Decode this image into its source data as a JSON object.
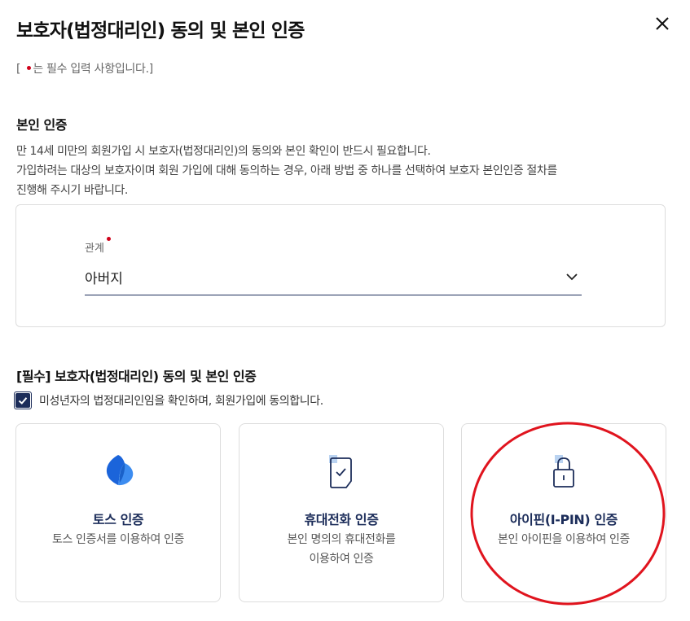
{
  "dialog": {
    "title": "보호자(법정대리인) 동의 및 본인 인증",
    "close_icon": "close-icon"
  },
  "required_note": {
    "prefix": "[ ",
    "suffix": "는 필수 입력 사항입니다.]"
  },
  "identity_section": {
    "title": "본인 인증",
    "desc_line1": "만 14세 미만의 회원가입 시 보호자(법정대리인)의 동의와 본인 확인이 반드시 필요합니다.",
    "desc_line2": "가입하려는 대상의 보호자이며 회원 가입에 대해 동의하는 경우, 아래 방법 중 하나를 선택하여 보호자 본인인증 절차를",
    "desc_line3": "진행해 주시기 바랍니다."
  },
  "relation_field": {
    "label": "관계",
    "value": "아버지"
  },
  "consent_section": {
    "title": "[필수] 보호자(법정대리인) 동의 및 본인 인증",
    "checkbox_label": "미성년자의 법정대리인임을 확인하며, 회원가입에 동의합니다.",
    "checked": true
  },
  "methods": [
    {
      "icon": "toss-logo-icon",
      "title": "토스 인증",
      "desc": "토스 인증서를 이용하여 인증"
    },
    {
      "icon": "phone-check-icon",
      "title": "휴대전화 인증",
      "desc_line1": "본인 명의의 휴대전화를",
      "desc_line2": "이용하여 인증"
    },
    {
      "icon": "lock-icon",
      "title": "아이핀(I-PIN) 인증",
      "desc": "본인 아이핀을 이용하여 인증"
    }
  ],
  "colors": {
    "primary": "#1c2d5a",
    "required": "#d0021b",
    "toss_blue": "#1b64da",
    "annotation_red": "#e0141e",
    "border": "#dddddd"
  }
}
